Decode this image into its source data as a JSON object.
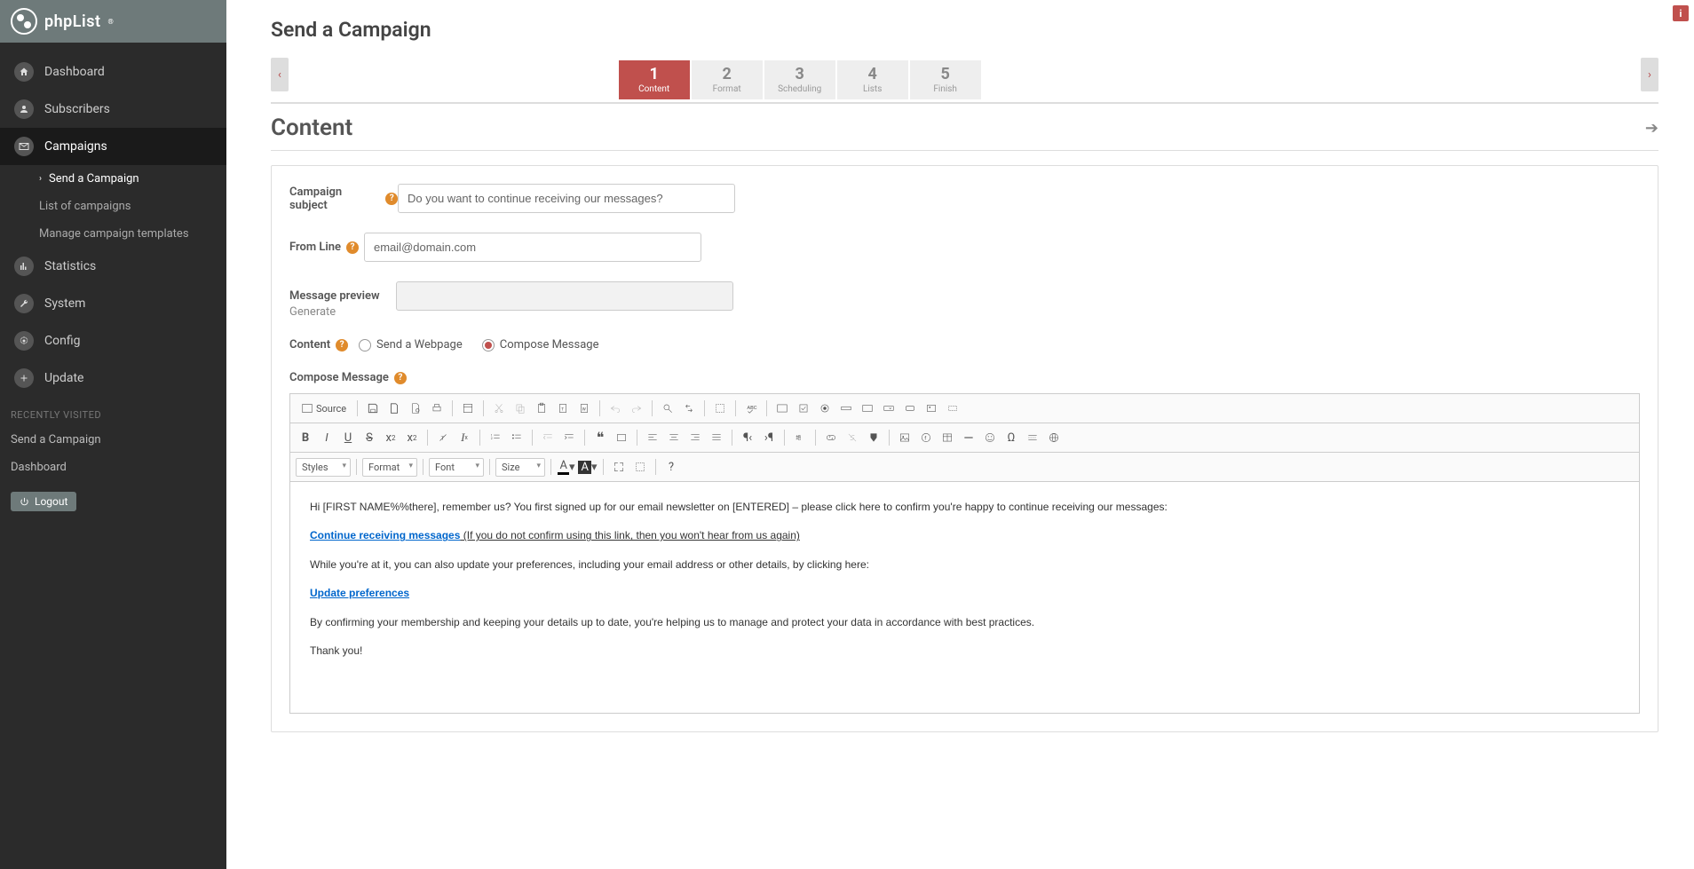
{
  "logo": "phpList",
  "sidebar": {
    "items": [
      {
        "label": "Dashboard"
      },
      {
        "label": "Subscribers"
      },
      {
        "label": "Campaigns"
      },
      {
        "label": "Statistics"
      },
      {
        "label": "System"
      },
      {
        "label": "Config"
      },
      {
        "label": "Update"
      }
    ],
    "campaigns_sub": [
      {
        "label": "Send a Campaign"
      },
      {
        "label": "List of campaigns"
      },
      {
        "label": "Manage campaign templates"
      }
    ],
    "recent_header": "RECENTLY VISITED",
    "recent": [
      {
        "label": "Send a Campaign"
      },
      {
        "label": "Dashboard"
      }
    ],
    "logout": "Logout"
  },
  "page": {
    "title": "Send a Campaign",
    "steps": [
      {
        "num": "1",
        "label": "Content"
      },
      {
        "num": "2",
        "label": "Format"
      },
      {
        "num": "3",
        "label": "Scheduling"
      },
      {
        "num": "4",
        "label": "Lists"
      },
      {
        "num": "5",
        "label": "Finish"
      }
    ],
    "section_title": "Content"
  },
  "form": {
    "subject_label": "Campaign subject",
    "subject_value": "Do you want to continue receiving our messages?",
    "from_label": "From Line",
    "from_value": "email@domain.com",
    "preview_label": "Message preview",
    "preview_value": "",
    "generate": "Generate",
    "content_label": "Content",
    "radio_webpage": "Send a Webpage",
    "radio_compose": "Compose Message",
    "compose_label": "Compose Message"
  },
  "toolbar": {
    "source": "Source",
    "styles": "Styles",
    "format": "Format",
    "font": "Font",
    "size": "Size"
  },
  "editor_body": {
    "p1a": "Hi [FIRST NAME%%there], remember us? You first signed up for our email newsletter on [ENTERED] – please click here to confirm you're happy to continue receiving our messages:",
    "link1": "Continue receiving messages",
    "p2_suffix": "   (If you do not confirm using this link, then you won't hear from us again)",
    "p3": "While you're at it, you can also update your preferences, including your email address or other details, by clicking here:",
    "link2": "Update preferences",
    "p4": "By confirming your membership and keeping your details up to date, you're helping us to manage and protect your data in accordance with best practices.",
    "p5": "Thank you!"
  }
}
